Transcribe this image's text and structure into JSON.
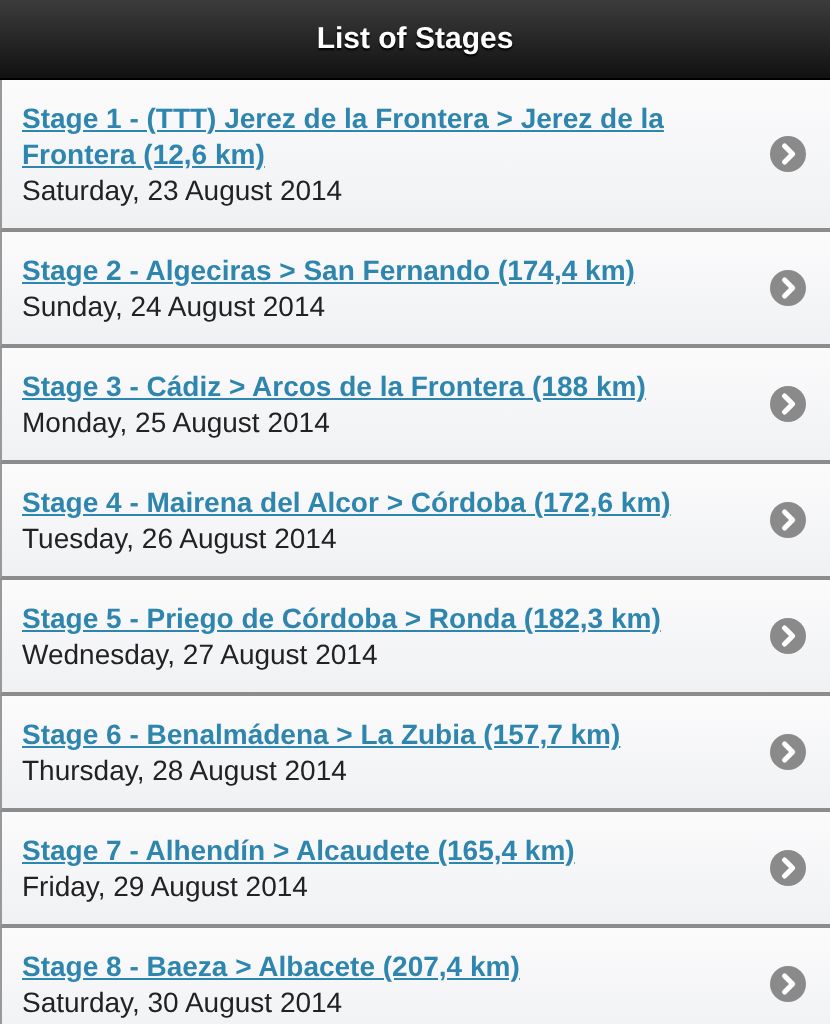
{
  "header": {
    "title": "List of Stages"
  },
  "stages": [
    {
      "title": "Stage 1 - (TTT) Jerez de la Frontera > Jerez de la Frontera (12,6 km)",
      "date": "Saturday, 23 August 2014"
    },
    {
      "title": "Stage 2 - Algeciras > San Fernando (174,4 km)",
      "date": "Sunday, 24 August 2014"
    },
    {
      "title": "Stage 3 - Cádiz > Arcos de la Frontera (188 km)",
      "date": "Monday, 25 August 2014"
    },
    {
      "title": "Stage 4 - Mairena del Alcor > Córdoba (172,6 km)",
      "date": "Tuesday, 26 August 2014"
    },
    {
      "title": "Stage 5 - Priego de Córdoba > Ronda (182,3 km)",
      "date": "Wednesday, 27 August 2014"
    },
    {
      "title": "Stage 6 - Benalmádena > La Zubia (157,7 km)",
      "date": "Thursday, 28 August 2014"
    },
    {
      "title": "Stage 7 - Alhendín > Alcaudete (165,4 km)",
      "date": "Friday, 29 August 2014"
    },
    {
      "title": "Stage 8 - Baeza > Albacete (207,4 km)",
      "date": "Saturday, 30 August 2014"
    }
  ]
}
